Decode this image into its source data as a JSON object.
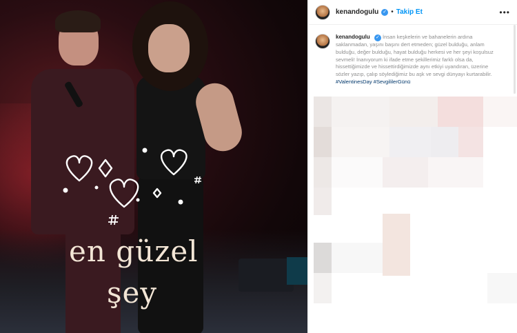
{
  "post": {
    "overlay_line1": "en güzel",
    "overlay_line2": "şey"
  },
  "header": {
    "username": "kenandogulu",
    "separator": "•",
    "follow_label": "Takip Et",
    "more_label": "•••"
  },
  "caption": {
    "username": "kenandogulu",
    "text": "İnsan keşkelerin ve bahanelerin ardına saklanmadan, yaşını başını dert etmeden; güzel bulduğu, anlam bulduğu, değer bulduğu, hayat bulduğu herkesi ve her şeyi koşulsuz sevmeli! İnanıyorum ki ifade etme şekillerimiz farklı olsa da, hissettiğimizde ve hissettirdiğimizde aynı etkiyi uyandıran, üzerine sözler yazıp, çalıp söylediğimiz bu aşk ve sevgi dünyayı kurtarabilir.",
    "hashtags": "#ValentinesDay #SevgililerGünü"
  },
  "colors": {
    "link": "#0095f6",
    "hashtag": "#00376b",
    "verified": "#3897f0"
  },
  "icons": [
    "verified-badge-icon",
    "more-options-icon",
    "heart-icon",
    "hashtag-icon"
  ]
}
